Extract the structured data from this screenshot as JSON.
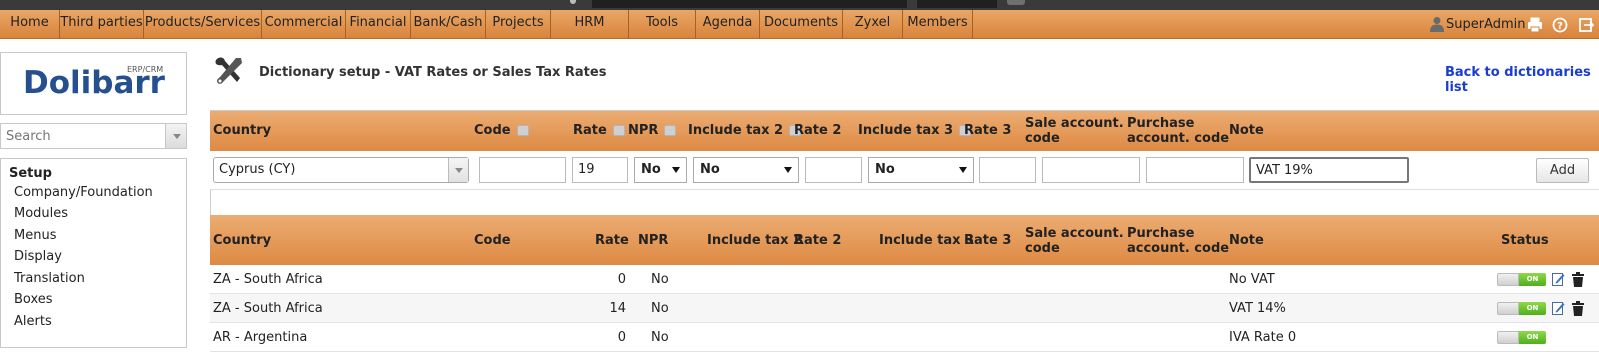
{
  "top_menu": {
    "items": [
      "Home",
      "Third parties",
      "Products/Services",
      "Commercial",
      "Financial",
      "Bank/Cash",
      "Projects",
      "HRM",
      "Tools",
      "Agenda",
      "Documents",
      "Zyxel",
      "Members"
    ],
    "user": "SuperAdmin",
    "icons": [
      "user-icon",
      "print-icon",
      "help-icon",
      "logout-icon"
    ]
  },
  "sidebar": {
    "logo_text": "Dolibarr",
    "logo_sub": "ERP/CRM",
    "search_placeholder": "Search",
    "title": "Setup",
    "items": [
      "Company/Foundation",
      "Modules",
      "Menus",
      "Display",
      "Translation",
      "Boxes",
      "Alerts"
    ]
  },
  "page": {
    "title": "Dictionary setup - VAT Rates or Sales Tax Rates",
    "back_link": "Back to dictionaries list"
  },
  "table": {
    "headers": {
      "country": "Country",
      "code": "Code",
      "rate": "Rate",
      "npr": "NPR",
      "include_tax2": "Include tax 2",
      "rate2": "Rate 2",
      "include_tax3": "Include tax 3",
      "rate3": "Rate 3",
      "sale_account_1": "Sale account.",
      "sale_account_2": "code",
      "purchase_account_1": "Purchase",
      "purchase_account_2": "account. code",
      "note": "Note",
      "status": "Status"
    },
    "form": {
      "country": "Cyprus (CY)",
      "code": "",
      "rate": "19",
      "npr": "No",
      "include_tax2": "No",
      "rate2": "",
      "include_tax3": "No",
      "rate3": "",
      "sale_account": "",
      "purchase_account": "",
      "note": "VAT 19%",
      "add_label": "Add"
    },
    "rows": [
      {
        "country": "ZA - South Africa",
        "rate": "0",
        "npr": "No",
        "note": "No VAT",
        "status": "ON"
      },
      {
        "country": "ZA - South Africa",
        "rate": "14",
        "npr": "No",
        "note": "VAT 14%",
        "status": "ON"
      },
      {
        "country": "AR - Argentina",
        "rate": "0",
        "npr": "No",
        "note": "IVA Rate 0",
        "status": "ON"
      }
    ]
  },
  "colors": {
    "menu_orange": "#d9843c",
    "header_orange": "#dd8a43",
    "link_blue": "#1a3ccf",
    "toggle_green": "#4fae1d"
  }
}
